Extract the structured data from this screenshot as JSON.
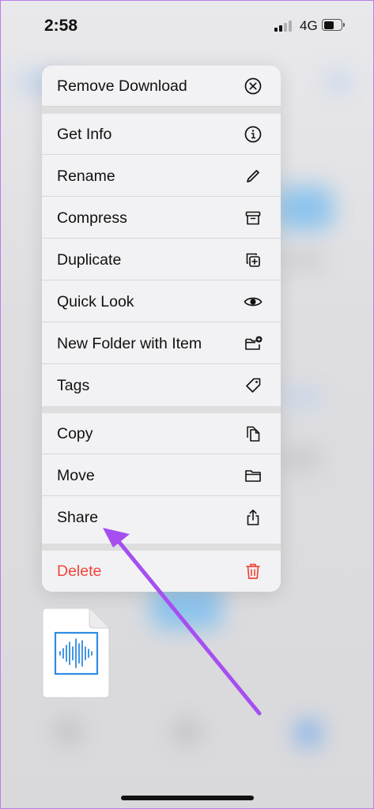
{
  "status_bar": {
    "time": "2:58",
    "network": "4G"
  },
  "menu": {
    "groups": [
      {
        "items": [
          {
            "label": "Remove Download",
            "icon": "x-circle-icon"
          }
        ]
      },
      {
        "items": [
          {
            "label": "Get Info",
            "icon": "info-circle-icon"
          },
          {
            "label": "Rename",
            "icon": "pencil-icon"
          },
          {
            "label": "Compress",
            "icon": "archive-box-icon"
          },
          {
            "label": "Duplicate",
            "icon": "duplicate-plus-icon"
          },
          {
            "label": "Quick Look",
            "icon": "eye-icon"
          },
          {
            "label": "New Folder with Item",
            "icon": "folder-badge-plus-icon"
          },
          {
            "label": "Tags",
            "icon": "tag-icon"
          }
        ]
      },
      {
        "items": [
          {
            "label": "Copy",
            "icon": "copy-doc-icon"
          },
          {
            "label": "Move",
            "icon": "folder-icon"
          },
          {
            "label": "Share",
            "icon": "share-icon"
          }
        ]
      },
      {
        "items": [
          {
            "label": "Delete",
            "icon": "trash-icon",
            "destructive": true
          }
        ]
      }
    ]
  },
  "file_preview": {
    "icon": "audio-waveform-icon"
  },
  "colors": {
    "destructive": "#f0453b",
    "annotation_arrow": "#a64ff0",
    "waveform": "#2f8be0"
  }
}
